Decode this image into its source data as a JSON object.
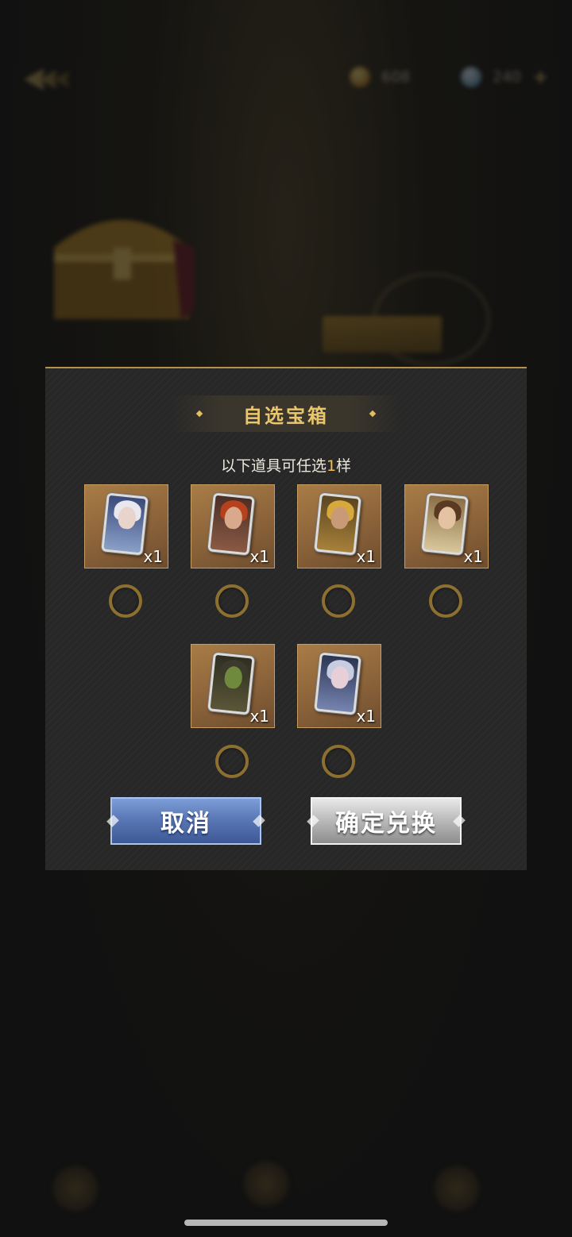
{
  "background": {
    "currencies": [
      {
        "icon": "gold-coin-icon",
        "value": "608"
      },
      {
        "icon": "diamond-icon",
        "value": "240"
      }
    ],
    "nav": [
      {
        "icon": "nav-left-icon"
      },
      {
        "icon": "nav-activity-icon"
      },
      {
        "icon": "nav-right-icon"
      }
    ]
  },
  "modal": {
    "title": "自选宝箱",
    "subtitle_prefix": "以下道具可任选",
    "subtitle_count": "1",
    "subtitle_suffix": "样",
    "items": [
      {
        "name": "hero-card-white-hair",
        "qty": "x1"
      },
      {
        "name": "hero-card-red-hair",
        "qty": "x1"
      },
      {
        "name": "hero-card-gold-crown",
        "qty": "x1"
      },
      {
        "name": "hero-card-noble",
        "qty": "x1"
      },
      {
        "name": "hero-card-orc",
        "qty": "x1"
      },
      {
        "name": "hero-card-silver-knight",
        "qty": "x1"
      }
    ],
    "cancel_label": "取消",
    "confirm_label": "确定兑换"
  },
  "colors": {
    "accent_gold": "#e9c66e",
    "cancel_blue": "#5a78b6",
    "confirm_gray": "#bdbdbd"
  }
}
